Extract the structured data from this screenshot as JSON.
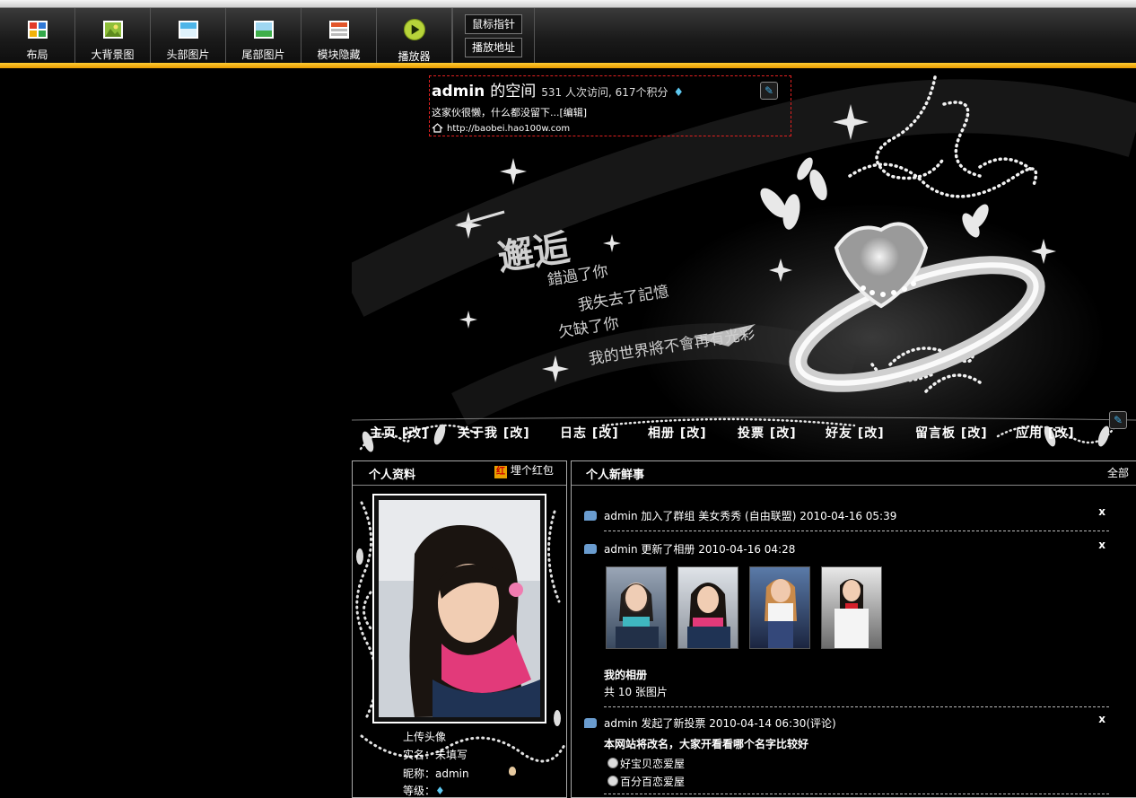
{
  "toolbar": {
    "buttons": [
      {
        "label": "布局",
        "icon": "layout-icon"
      },
      {
        "label": "大背景图",
        "icon": "background-image-icon"
      },
      {
        "label": "头部图片",
        "icon": "header-image-icon"
      },
      {
        "label": "尾部图片",
        "icon": "footer-image-icon"
      },
      {
        "label": "模块隐藏",
        "icon": "module-hide-icon"
      },
      {
        "label": "播放器",
        "icon": "play-icon"
      }
    ],
    "small_buttons": [
      "鼠标指针",
      "播放地址"
    ]
  },
  "header": {
    "name": "admin",
    "title_suffix": "的空间",
    "stats": "531 人次访问, 617个积分",
    "description": "这家伙很懒，什么都没留下...[编辑]",
    "url": "http://baobei.hao100w.com"
  },
  "banner": {
    "title": "邂逅",
    "lines": [
      "錯過了你",
      "我失去了記憶",
      "欠缺了你",
      "我的世界將不會再有光彩"
    ]
  },
  "nav": {
    "items": [
      {
        "label": "主页",
        "edit": "[改]"
      },
      {
        "label": "关于我",
        "edit": "[改]"
      },
      {
        "label": "日志",
        "edit": "[改]"
      },
      {
        "label": "相册",
        "edit": "[改]"
      },
      {
        "label": "投票",
        "edit": "[改]"
      },
      {
        "label": "好友",
        "edit": "[改]"
      },
      {
        "label": "留言板",
        "edit": "[改]"
      },
      {
        "label": "应用",
        "edit": "[改]"
      }
    ]
  },
  "profile": {
    "title": "个人资料",
    "red_packet": "埋个红包",
    "red_packet_badge": "红",
    "upload_avatar": "上传头像",
    "real_name": "实名：未填写",
    "nickname": "昵称：admin",
    "level": "等级："
  },
  "feed": {
    "title": "个人新鲜事",
    "all": "全部",
    "items": [
      {
        "text": "admin 加入了群组 美女秀秀 (自由联盟) 2010-04-16 05:39",
        "close": "x"
      },
      {
        "text": "admin 更新了相册 2010-04-16 04:28",
        "close": "x"
      },
      {
        "text": "admin 发起了新投票 2010-04-14 06:30(评论)",
        "close": "x"
      }
    ],
    "album": {
      "title": "我的相册",
      "count": "共 10 张图片"
    },
    "poll": {
      "question": "本网站将改名，大家开看看哪个名字比较好",
      "options": [
        "好宝贝恋爱屋",
        "百分百恋爱屋"
      ]
    }
  },
  "colors": {
    "accent": "#f5b800",
    "header_border": "#e02020"
  }
}
